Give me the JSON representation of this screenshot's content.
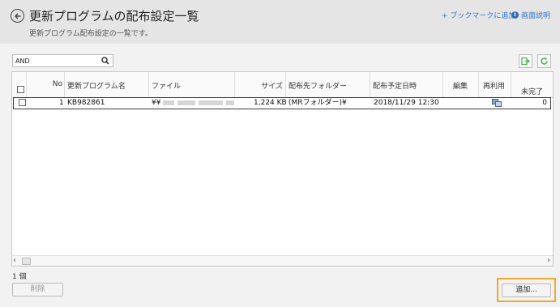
{
  "header": {
    "title": "更新プログラムの配布設定一覧",
    "subtitle": "更新プログラム配布設定の一覧です。",
    "bookmark_link": "+ ブックマークに追加",
    "help_link": "画面説明",
    "help_icon_glyph": "i"
  },
  "search": {
    "value": "AND",
    "placeholder": ""
  },
  "table": {
    "columns": [
      "No",
      "更新プログラム名",
      "ファイル",
      "サイズ",
      "配布先フォルダー",
      "配布予定日時",
      "編集",
      "再利用",
      "未完了"
    ],
    "rows": [
      {
        "no": "1",
        "name": "KB982861",
        "file": "¥¥",
        "size": "1,224 KB",
        "folder": "(MRフォルダー)¥",
        "scheduled": "2018/11/29 12:30",
        "edit": "",
        "reuse_icon": "copy-icon",
        "incomplete": "0"
      }
    ]
  },
  "footer": {
    "count": "1 個",
    "delete_label": "削除",
    "add_label": "追加..."
  },
  "colors": {
    "accent_highlight": "#f0a830",
    "link": "#3377cc",
    "tool_icon": "#4caf50"
  }
}
